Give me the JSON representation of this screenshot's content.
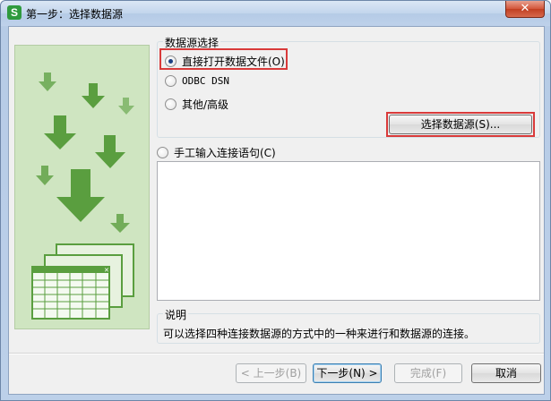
{
  "window": {
    "title": "第一步：选择数据源",
    "app_icon_letter": "S",
    "close_glyph": "✕"
  },
  "datasource_group": {
    "legend": "数据源选择",
    "options": [
      {
        "label": "直接打开数据文件(O)",
        "checked": true
      },
      {
        "label": "ODBC DSN",
        "checked": false
      },
      {
        "label": "其他/高级",
        "checked": false
      }
    ],
    "select_button": "选择数据源(S)..."
  },
  "manual_option": {
    "label": "手工输入连接语句(C)",
    "checked": false
  },
  "connection_text": "",
  "description": {
    "legend": "说明",
    "text": "可以选择四种连接数据源的方式中的一种来进行和数据源的连接。"
  },
  "buttons": {
    "prev": "< 上一步(B)",
    "next": "下一步(N) >",
    "finish": "完成(F)",
    "cancel": "取消"
  },
  "colors": {
    "arrow_green": "#5a9e3f",
    "panel_bg": "#cfe5c1",
    "highlight_red": "#d93a3a"
  }
}
